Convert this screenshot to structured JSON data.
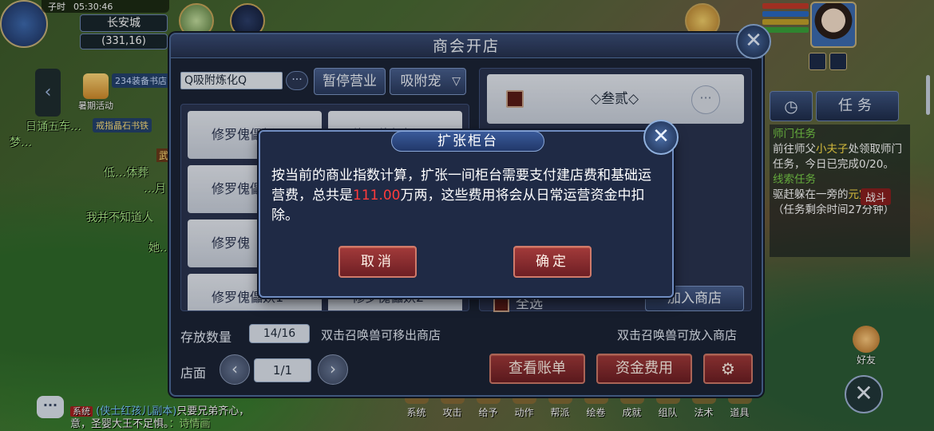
{
  "hud": {
    "time_label": "子时",
    "clock": "05:30:46",
    "city": "长安城",
    "coords": "(331,16)",
    "event_label": "暑期活动",
    "tag_234": "234装备书店",
    "tag_ring": "戒指晶石书铁",
    "tag_wu": "武",
    "npc_lines": [
      "日诵五车…",
      "梦…",
      "低…体葬",
      "…月",
      "我并不知道人",
      "她…"
    ]
  },
  "tasks": {
    "tab_label": "任务",
    "shimen_head": "师门任务",
    "shimen_body_1": "前往师父",
    "shimen_npc": "小夫子",
    "shimen_body_2": "处领取师门任务，今日已完成0/20。",
    "xiansuo_head": "线索任务",
    "battle_tag": "战斗",
    "xiansuo_body_1": "驱赶躲在一旁的",
    "xiansuo_target": "元宝龟",
    "xiansuo_body_2": "。（任务剩余时间27分钟）"
  },
  "friend_label": "好友",
  "bottom_menu": [
    "系统",
    "攻击",
    "给予",
    "动作",
    "帮派",
    "绘卷",
    "成就",
    "组队",
    "法术",
    "道具"
  ],
  "chat": {
    "sys_tag": "系统",
    "channel": "(侠士红孩儿副本)",
    "line1": "只要兄弟齐心，",
    "line2": "意，圣婴大王不足惧。",
    "name": "：诗情画"
  },
  "shop": {
    "title": "商会开店",
    "search_value": "Q吸附炼化Q",
    "pause_label": "暂停营业",
    "type_select": "吸附宠",
    "pet_cards": [
      "修罗傀儡妖",
      "修罗傀儡妖",
      "修罗傀儡",
      "修罗傀",
      "修罗傀",
      "修罗傀儡妖1",
      "修罗傀儡妖2"
    ],
    "counter_name": "◇叁贰◇",
    "select_all": "全选",
    "add_shop": "加入商店",
    "store_label": "存放数量",
    "store_count": "14/16",
    "hint_left": "双击召唤兽可移出商店",
    "hint_right": "双击召唤兽可放入商店",
    "page_label": "店面",
    "page_indicator": "1/1",
    "bill_label": "查看账单",
    "fund_label": "资金费用"
  },
  "dialog": {
    "title": "扩张柜台",
    "text_1": "按当前的商业指数计算，扩张一间柜台需要支付建店费和基础运营费，总共是",
    "amount": "111.00",
    "text_2": "万两，这些费用将会从日常运营资金中扣除。",
    "cancel": "取消",
    "confirm": "确定"
  },
  "colors": {
    "money_red": "#ff3b3b",
    "task_green": "#7ad04a",
    "highlight_yellow": "#ffe14a",
    "panel_bg": "#1c2436"
  }
}
